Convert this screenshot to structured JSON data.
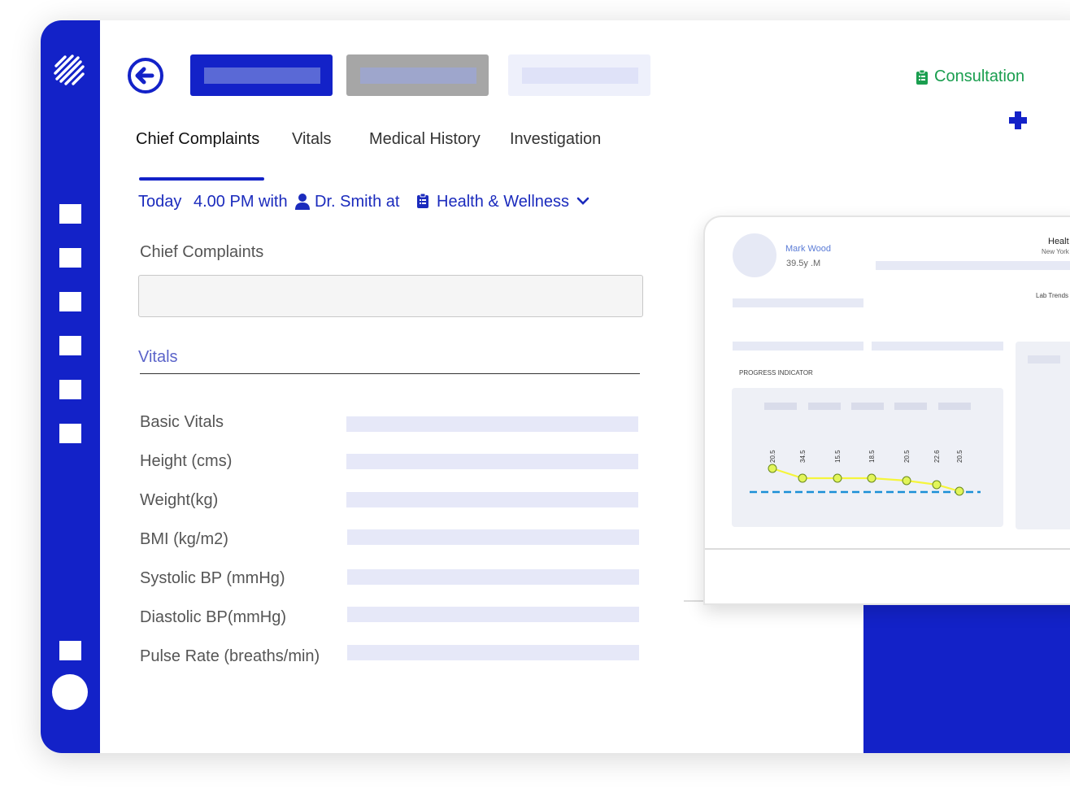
{
  "header": {
    "consultation_label": "Consultation"
  },
  "tabs": [
    {
      "label": "Chief Complaints",
      "active": true
    },
    {
      "label": "Vitals"
    },
    {
      "label": "Medical History"
    },
    {
      "label": "Investigation"
    }
  ],
  "appointment": {
    "day": "Today",
    "time": "4.00 PM with",
    "doctor": "Dr. Smith at",
    "clinic": "Health & Wellness"
  },
  "chief_complaints": {
    "label": "Chief Complaints",
    "value": ""
  },
  "vitals": {
    "heading": "Vitals",
    "rows": [
      {
        "label": "Basic Vitals"
      },
      {
        "label": "Height (cms)"
      },
      {
        "label": "Weight(kg)"
      },
      {
        "label": "BMI (kg/m2)"
      },
      {
        "label": "Systolic BP (mmHg)"
      },
      {
        "label": "Diastolic BP(mmHg)"
      },
      {
        "label": "Pulse Rate (breaths/min)"
      }
    ]
  },
  "preview": {
    "patient_name": "Mark Wood",
    "patient_age": "39.5y .M",
    "right_title": "Healt",
    "right_subtitle": "New York",
    "lab_trends": "Lab Trends",
    "progress_label": "PROGRESS INDICATOR"
  },
  "chart_data": {
    "type": "line",
    "title": "PROGRESS INDICATOR",
    "values": [
      20.5,
      34.5,
      15.5,
      18.5,
      20.5,
      22.6,
      20.5
    ],
    "data_labels": [
      "20.5",
      "34.5",
      "15.5",
      "18.5",
      "20.5",
      "22.6",
      "20.5"
    ],
    "reference_line": "dashed",
    "colors": {
      "line": "#f5f53c",
      "marker": "#e2f55a",
      "reference": "#1a8fd6"
    }
  },
  "colors": {
    "brand": "#1322c8",
    "consultation": "#1a9e4f",
    "placeholder": "#e6e8f8"
  }
}
